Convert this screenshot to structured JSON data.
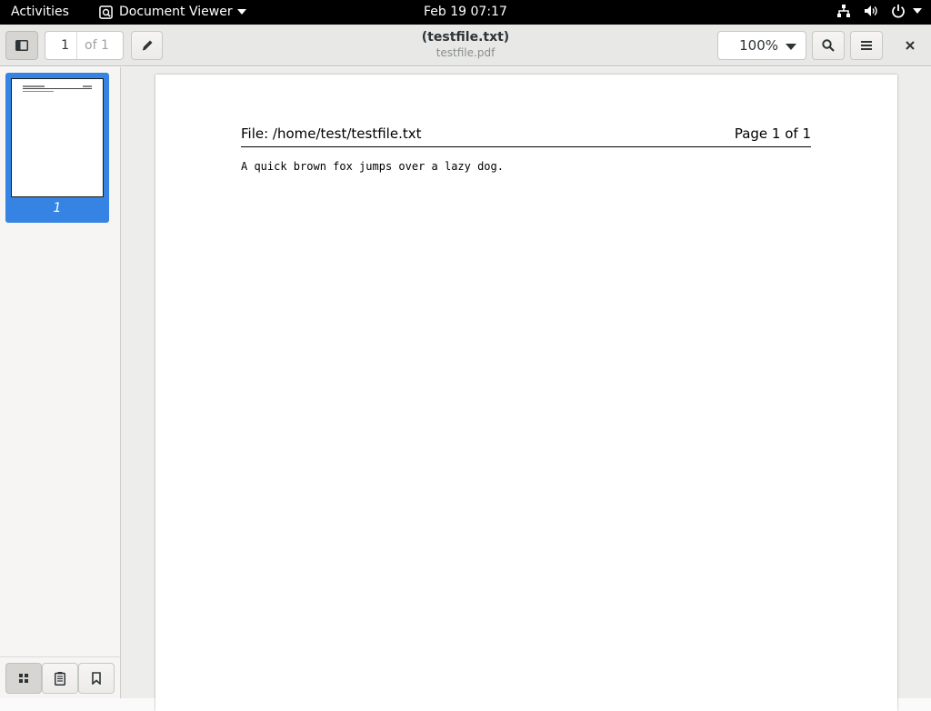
{
  "topbar": {
    "activities": "Activities",
    "app_name": "Document Viewer",
    "clock": "Feb 19  07:17",
    "icons": [
      "network-icon",
      "volume-icon",
      "power-icon"
    ]
  },
  "headerbar": {
    "current_page": "1",
    "page_total": "of 1",
    "title": "(testfile.txt)",
    "subtitle": "testfile.pdf",
    "zoom": "100%",
    "icons": [
      "sidebar-toggle-icon",
      "pencil-icon",
      "search-icon",
      "hamburger-menu-icon",
      "close-icon"
    ]
  },
  "sidebar": {
    "thumbnail_label": "1",
    "bottom_icons": [
      "grid-icon",
      "outline-icon",
      "bookmark-icon"
    ]
  },
  "document": {
    "header_left": "File: /home/test/testfile.txt",
    "header_right": "Page 1 of 1",
    "body": "A quick brown fox jumps over a lazy dog."
  },
  "colors": {
    "accent": "#3584e4",
    "topbar": "#000000",
    "headerbar": "#e8e8e7"
  }
}
